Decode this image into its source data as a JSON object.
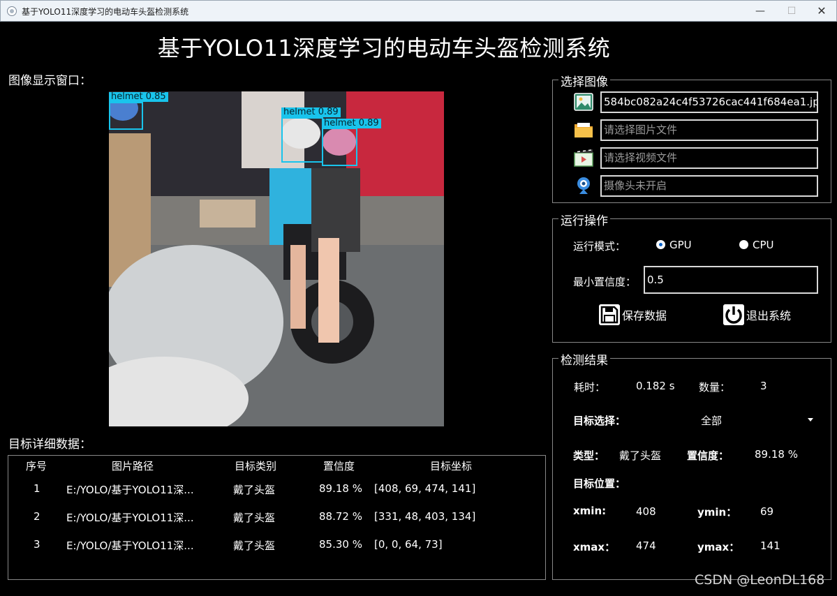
{
  "window": {
    "title": "基于YOLO11深度学习的电动车头盔检测系统",
    "minimize_glyph": "—",
    "maximize_glyph": "☐",
    "close_glyph": "✕"
  },
  "app_title": "基于YOLO11深度学习的电动车头盔检测系统",
  "viewer": {
    "label": "图像显示窗口：",
    "detections": [
      {
        "tag": "helmet  0.85"
      },
      {
        "tag": "helmet  0.89"
      },
      {
        "tag": "helmet  0.89"
      }
    ]
  },
  "select_image": {
    "title": "选择图像",
    "image_file": "584bc082a24c4f53726cac441f684ea1.jpg",
    "image_placeholder": "请选择图片文件",
    "video_placeholder": "请选择视频文件",
    "camera_placeholder": "摄像头未开启",
    "icons": [
      "image-icon",
      "folder-icon",
      "video-icon",
      "webcam-icon"
    ]
  },
  "run_ops": {
    "title": "运行操作",
    "mode_label": "运行模式：",
    "gpu_label": "GPU",
    "cpu_label": "CPU",
    "selected_mode": "GPU",
    "conf_label": "最小置信度：",
    "conf_value": "0.5",
    "save_label": "保存数据",
    "exit_label": "退出系统"
  },
  "results": {
    "title": "检测结果",
    "time_label": "耗时：",
    "time_value": "0.182 s",
    "count_label": "数量：",
    "count_value": "3",
    "target_select_label": "目标选择：",
    "target_select_value": "全部",
    "type_label": "类型：",
    "type_value": "戴了头盔",
    "conf_label": "置信度：",
    "conf_value": "89.18 %",
    "position_label": "目标位置：",
    "xmin_label": "xmin:",
    "xmin_value": "408",
    "ymin_label": "ymin：",
    "ymin_value": "69",
    "xmax_label": "xmax：",
    "xmax_value": "474",
    "ymax_label": "ymax：",
    "ymax_value": "141"
  },
  "table": {
    "label": "目标详细数据：",
    "headers": [
      "序号",
      "图片路径",
      "目标类别",
      "置信度",
      "目标坐标"
    ],
    "rows": [
      [
        "1",
        "E:/YOLO/基于YOLO11深...",
        "戴了头盔",
        "89.18 %",
        "[408, 69, 474, 141]"
      ],
      [
        "2",
        "E:/YOLO/基于YOLO11深...",
        "戴了头盔",
        "88.72 %",
        "[331, 48, 403, 134]"
      ],
      [
        "3",
        "E:/YOLO/基于YOLO11深...",
        "戴了头盔",
        "85.30 %",
        "[0, 0, 64, 73]"
      ]
    ]
  },
  "watermark": "CSDN @LeonDL168",
  "colors": {
    "detection_box": "#19c4ec",
    "radio_selected": "#0a62c8",
    "background": "#000000"
  }
}
